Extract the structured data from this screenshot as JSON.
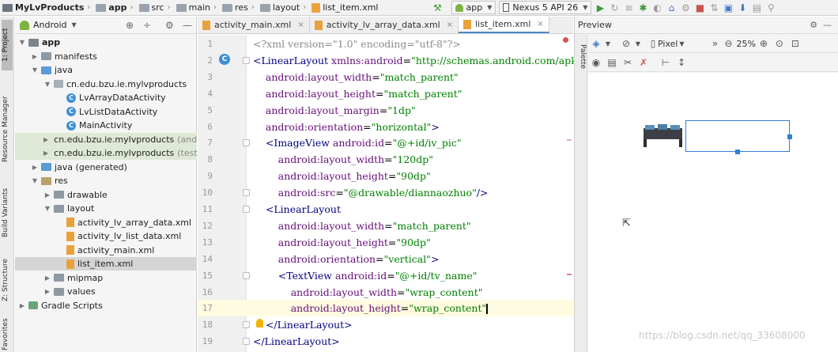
{
  "breadcrumb": [
    {
      "label": "MyLvProducts",
      "icon": "project-icon",
      "bold": true
    },
    {
      "label": "app",
      "icon": "module-folder-icon",
      "bold": true
    },
    {
      "label": "src",
      "icon": "folder-icon"
    },
    {
      "label": "main",
      "icon": "folder-icon"
    },
    {
      "label": "res",
      "icon": "folder-icon"
    },
    {
      "label": "layout",
      "icon": "folder-icon"
    },
    {
      "label": "list_item.xml",
      "icon": "xml-file-icon"
    }
  ],
  "toolbar": {
    "run_config": "app",
    "device": "Nexus 5 API 26"
  },
  "left_strip": {
    "tabs": [
      "1: Project",
      "Resource Manager",
      "Build Variants",
      "Z: Structure",
      "Favorites"
    ]
  },
  "project": {
    "view_label": "Android",
    "tree": [
      {
        "label": "app",
        "depth": 0,
        "kind": "module",
        "expanded": true,
        "bold": true
      },
      {
        "label": "manifests",
        "depth": 1,
        "kind": "folder",
        "expanded": false
      },
      {
        "label": "java",
        "depth": 1,
        "kind": "java",
        "expanded": true
      },
      {
        "label": "cn.edu.bzu.ie.mylvproducts",
        "depth": 2,
        "kind": "package",
        "expanded": true
      },
      {
        "label": "LvArrayDataActivity",
        "depth": 3,
        "kind": "class"
      },
      {
        "label": "LvListDataActivity",
        "depth": 3,
        "kind": "class"
      },
      {
        "label": "MainActivity",
        "depth": 3,
        "kind": "class"
      },
      {
        "label": "cn.edu.bzu.ie.mylvproducts",
        "suffix": "(andr",
        "depth": 2,
        "kind": "package",
        "expanded": false,
        "highlight": true
      },
      {
        "label": "cn.edu.bzu.ie.mylvproducts",
        "suffix": "(test)",
        "depth": 2,
        "kind": "package",
        "expanded": false,
        "highlight": true
      },
      {
        "label": "java (generated)",
        "depth": 1,
        "kind": "java",
        "expanded": false
      },
      {
        "label": "res",
        "depth": 1,
        "kind": "res",
        "expanded": true
      },
      {
        "label": "drawable",
        "depth": 2,
        "kind": "folder",
        "expanded": false
      },
      {
        "label": "layout",
        "depth": 2,
        "kind": "folder",
        "expanded": true
      },
      {
        "label": "activity_lv_array_data.xml",
        "depth": 3,
        "kind": "xml"
      },
      {
        "label": "activity_lv_list_data.xml",
        "depth": 3,
        "kind": "xml"
      },
      {
        "label": "activity_main.xml",
        "depth": 3,
        "kind": "xml"
      },
      {
        "label": "list_item.xml",
        "depth": 3,
        "kind": "xml",
        "selected": true
      },
      {
        "label": "mipmap",
        "depth": 2,
        "kind": "folder",
        "expanded": false
      },
      {
        "label": "values",
        "depth": 2,
        "kind": "folder",
        "expanded": false
      },
      {
        "label": "Gradle Scripts",
        "depth": 0,
        "kind": "gradle",
        "expanded": false
      }
    ]
  },
  "editor": {
    "tabs": [
      {
        "label": "activity_main.xml",
        "active": false
      },
      {
        "label": "activity_lv_array_data.xml",
        "active": false
      },
      {
        "label": "list_item.xml",
        "active": true
      }
    ],
    "lines": [
      {
        "no": "1",
        "parts": [
          [
            "pi",
            "<?xml version=\"1.0\" encoding=\"utf-8\"?>"
          ]
        ]
      },
      {
        "no": "2",
        "parts": [
          [
            "tag",
            "<LinearLayout "
          ],
          [
            "attr",
            "xmlns:android"
          ],
          [
            "bracket",
            "="
          ],
          [
            "val",
            "\"http://schemas.android.com/apk"
          ]
        ]
      },
      {
        "no": "3",
        "parts": [
          [
            "sp",
            "    "
          ],
          [
            "attr",
            "android:layout_width"
          ],
          [
            "bracket",
            "="
          ],
          [
            "val",
            "\"match_parent\""
          ]
        ]
      },
      {
        "no": "4",
        "parts": [
          [
            "sp",
            "    "
          ],
          [
            "attr",
            "android:layout_height"
          ],
          [
            "bracket",
            "="
          ],
          [
            "val",
            "\"match_parent\""
          ]
        ]
      },
      {
        "no": "5",
        "parts": [
          [
            "sp",
            "    "
          ],
          [
            "attr",
            "android:layout_margin"
          ],
          [
            "bracket",
            "="
          ],
          [
            "val",
            "\"1dp\""
          ]
        ]
      },
      {
        "no": "6",
        "parts": [
          [
            "sp",
            "    "
          ],
          [
            "attr",
            "android:orientation"
          ],
          [
            "bracket",
            "="
          ],
          [
            "val",
            "\"horizontal\""
          ],
          [
            "tag",
            ">"
          ]
        ]
      },
      {
        "no": "7",
        "parts": [
          [
            "sp",
            "    "
          ],
          [
            "tag",
            "<ImageView "
          ],
          [
            "attr",
            "android:id"
          ],
          [
            "bracket",
            "="
          ],
          [
            "val",
            "\"@+id/iv_pic\""
          ]
        ]
      },
      {
        "no": "8",
        "parts": [
          [
            "sp",
            "        "
          ],
          [
            "attr",
            "android:layout_width"
          ],
          [
            "bracket",
            "="
          ],
          [
            "val",
            "\"120dp\""
          ]
        ]
      },
      {
        "no": "9",
        "parts": [
          [
            "sp",
            "        "
          ],
          [
            "attr",
            "android:layout_height"
          ],
          [
            "bracket",
            "="
          ],
          [
            "val",
            "\"90dp\""
          ]
        ]
      },
      {
        "no": "10",
        "parts": [
          [
            "sp",
            "        "
          ],
          [
            "attr",
            "android:src"
          ],
          [
            "bracket",
            "="
          ],
          [
            "val",
            "\"@drawable/diannaozhuo\""
          ],
          [
            "tag",
            "/>"
          ]
        ]
      },
      {
        "no": "11",
        "parts": [
          [
            "sp",
            "    "
          ],
          [
            "tag",
            "<LinearLayout"
          ]
        ]
      },
      {
        "no": "12",
        "parts": [
          [
            "sp",
            "        "
          ],
          [
            "attr",
            "android:layout_width"
          ],
          [
            "bracket",
            "="
          ],
          [
            "val",
            "\"match_parent\""
          ]
        ]
      },
      {
        "no": "13",
        "parts": [
          [
            "sp",
            "        "
          ],
          [
            "attr",
            "android:layout_height"
          ],
          [
            "bracket",
            "="
          ],
          [
            "val",
            "\"90dp\""
          ]
        ]
      },
      {
        "no": "14",
        "parts": [
          [
            "sp",
            "        "
          ],
          [
            "attr",
            "android:orientation"
          ],
          [
            "bracket",
            "="
          ],
          [
            "val",
            "\"vertical\""
          ],
          [
            "tag",
            ">"
          ]
        ]
      },
      {
        "no": "15",
        "parts": [
          [
            "sp",
            "        "
          ],
          [
            "tag",
            "<TextView "
          ],
          [
            "attr",
            "android:id"
          ],
          [
            "bracket",
            "="
          ],
          [
            "val",
            "\"@+id/tv_name\""
          ]
        ]
      },
      {
        "no": "16",
        "parts": [
          [
            "sp",
            "            "
          ],
          [
            "attr",
            "android:layout_width"
          ],
          [
            "bracket",
            "="
          ],
          [
            "val",
            "\"wrap_content\""
          ]
        ]
      },
      {
        "no": "17",
        "parts": [
          [
            "sp",
            "            "
          ],
          [
            "attr",
            "android:layout_height"
          ],
          [
            "bracket",
            "="
          ],
          [
            "val",
            "\"wrap_content\""
          ]
        ],
        "current": true
      },
      {
        "no": "18",
        "parts": [
          [
            "sp",
            "    "
          ],
          [
            "tag",
            "</LinearLayout>"
          ]
        ]
      },
      {
        "no": "19",
        "parts": [
          [
            "tag",
            "</LinearLayout>"
          ]
        ]
      }
    ]
  },
  "preview": {
    "title": "Preview",
    "device": "Pixel",
    "zoom": "25%",
    "palette_label": "Palette"
  },
  "watermark": "https://blog.csdn.net/qq_33608000"
}
